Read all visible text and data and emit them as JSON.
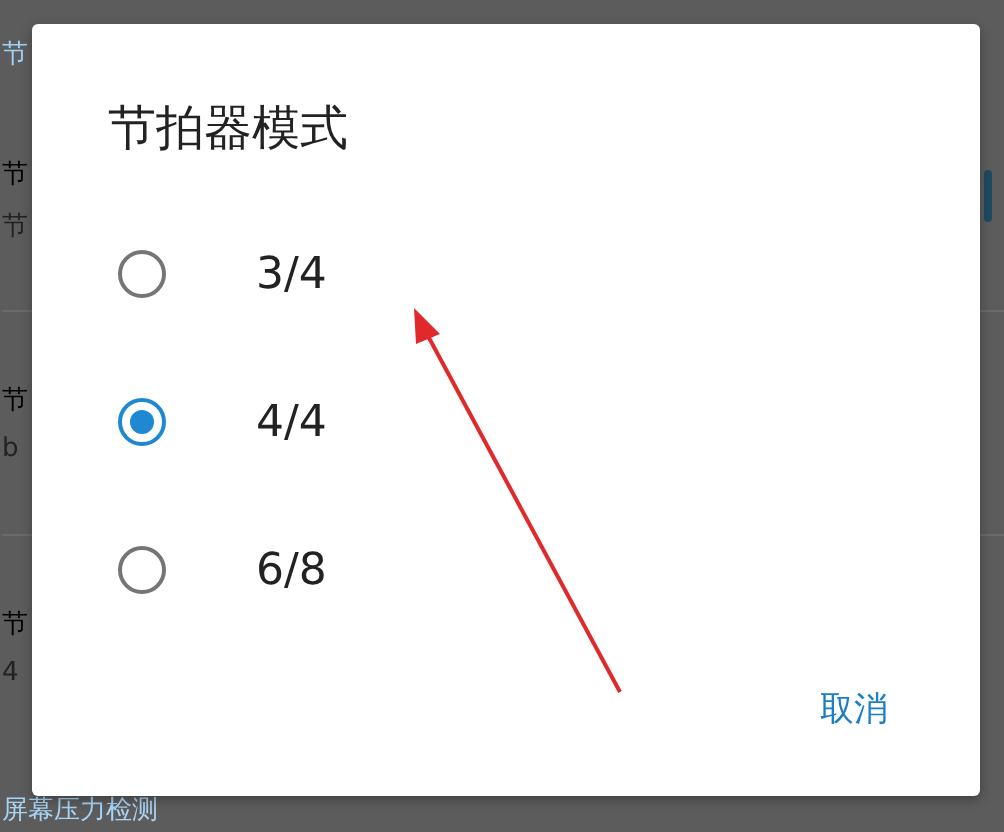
{
  "background": {
    "section_header": "节",
    "rows": [
      {
        "title": "节",
        "subtitle": "节"
      },
      {
        "title": "节",
        "subtitle": "b"
      },
      {
        "title": "节",
        "subtitle": "4"
      }
    ],
    "footer_item": "屏幕压力检测"
  },
  "dialog": {
    "title": "节拍器模式",
    "options": [
      {
        "label": "3/4",
        "selected": false
      },
      {
        "label": "4/4",
        "selected": true
      },
      {
        "label": "6/8",
        "selected": false
      }
    ],
    "cancel": "取消"
  }
}
